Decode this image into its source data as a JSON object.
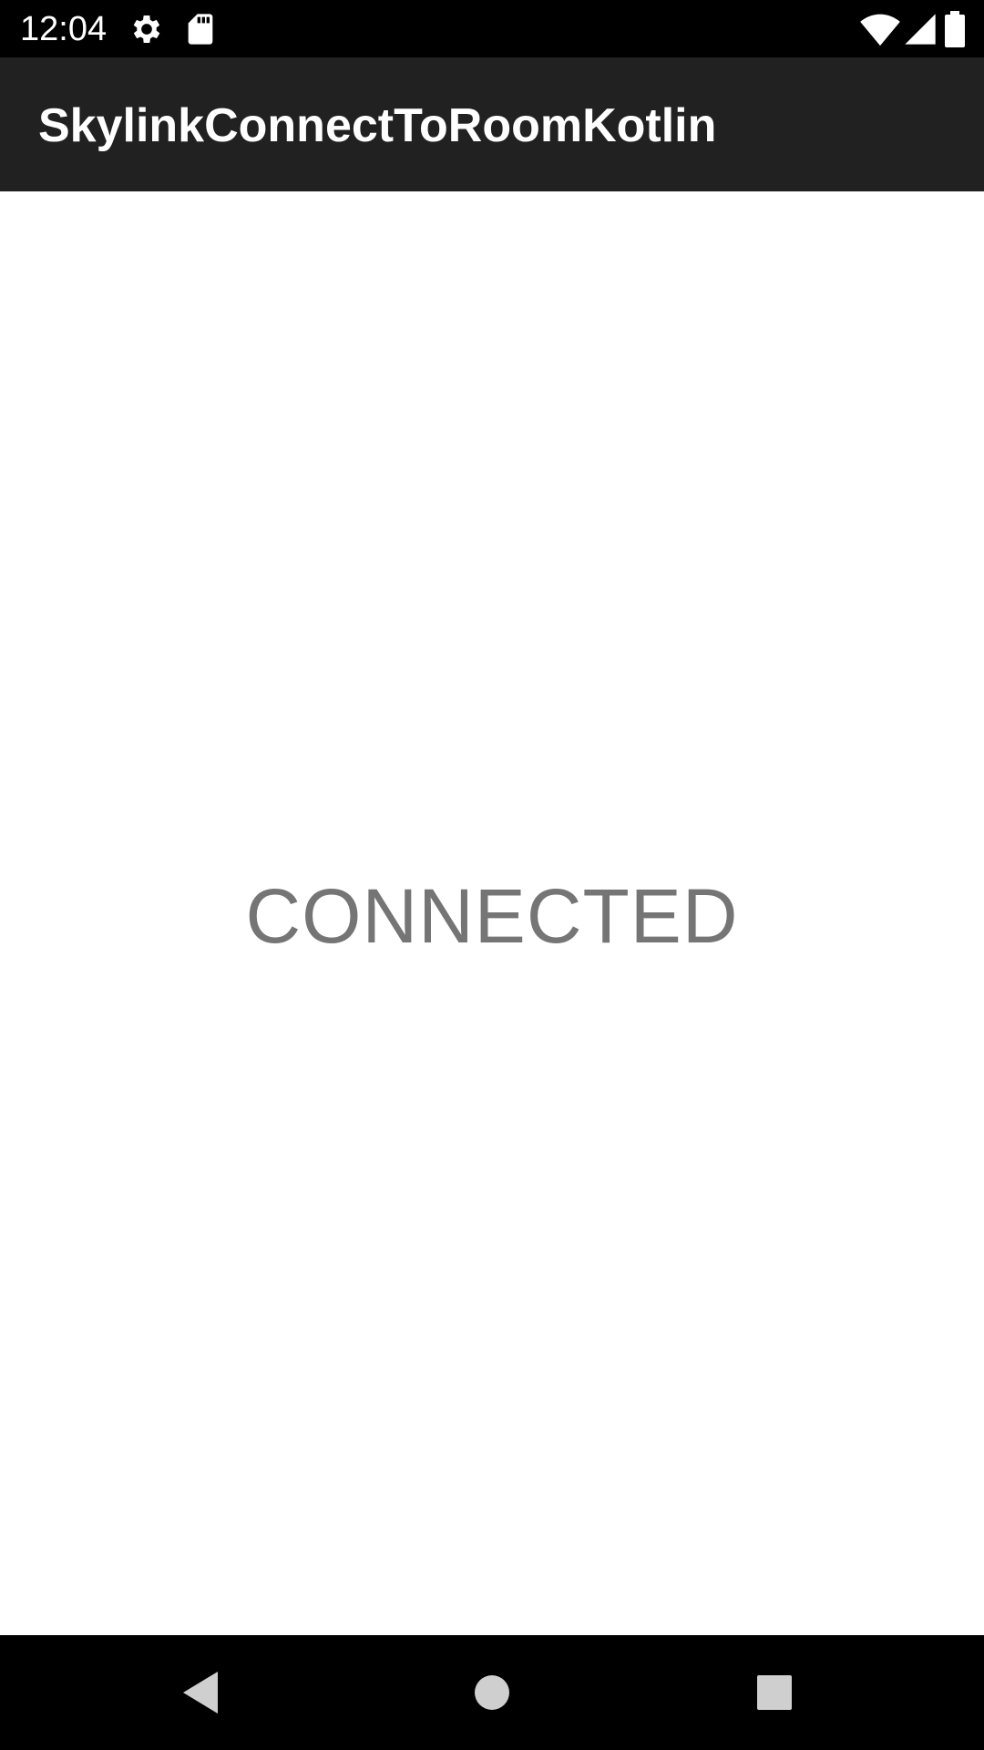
{
  "status_bar": {
    "time": "12:04",
    "icons": [
      "settings-icon",
      "sd-card-icon",
      "wifi-icon",
      "signal-icon",
      "battery-icon"
    ]
  },
  "app_bar": {
    "title": "SkylinkConnectToRoomKotlin",
    "background": "#212121"
  },
  "main": {
    "status_text": "CONNECTED",
    "status_color": "#757575"
  },
  "nav_bar": {
    "buttons": [
      "back-icon",
      "home-icon",
      "recents-icon"
    ]
  }
}
